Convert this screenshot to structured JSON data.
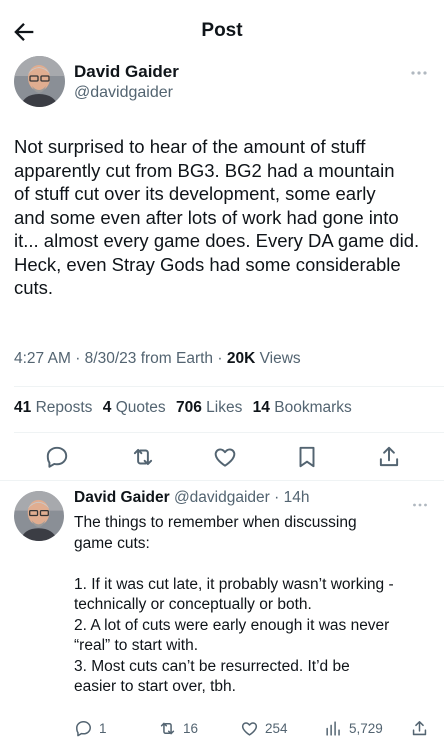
{
  "header": {
    "title": "Post"
  },
  "author": {
    "name": "David Gaider",
    "handle": "@davidgaider"
  },
  "tweet": {
    "lines": [
      "Not surprised to hear of the amount of stuff",
      "apparently cut from BG3. BG2 had a mountain",
      "of stuff cut over its development, some early",
      "and some even after lots of work had gone into",
      "it... almost every game does. Every DA game did.",
      "Heck, even Stray Gods had some considerable",
      "cuts."
    ],
    "time": "4:27 AM",
    "date": "8/30/23",
    "source": "from Earth",
    "views_count": "20K",
    "views_label": "Views"
  },
  "stats": {
    "reposts_count": "41",
    "reposts_label": "Reposts",
    "quotes_count": "4",
    "quotes_label": "Quotes",
    "likes_count": "706",
    "likes_label": "Likes",
    "bookmarks_count": "14",
    "bookmarks_label": "Bookmarks"
  },
  "reply": {
    "name": "David Gaider",
    "handle": "@davidgaider",
    "age": "14h",
    "lines": [
      "The things to remember when discussing",
      "game cuts:",
      "",
      "1. If it was cut late, it probably wasn’t working -",
      "technically or conceptually or both.",
      "2. A lot of cuts were early enough it was never",
      "“real” to start with.",
      "3. Most cuts can’t be resurrected. It’d be",
      "easier to start over, tbh."
    ],
    "replies": "1",
    "reposts": "16",
    "likes": "254",
    "views": "5,729"
  },
  "icons": {
    "back": "arrow-left-icon",
    "more": "ellipsis-icon",
    "reply": "comment-icon",
    "repost": "repost-icon",
    "like": "heart-icon",
    "bookmark": "bookmark-icon",
    "share": "share-icon",
    "views": "bar-chart-icon"
  },
  "colors": {
    "text": "#0f1419",
    "secondary": "#536471",
    "divider": "#eff3f4"
  }
}
